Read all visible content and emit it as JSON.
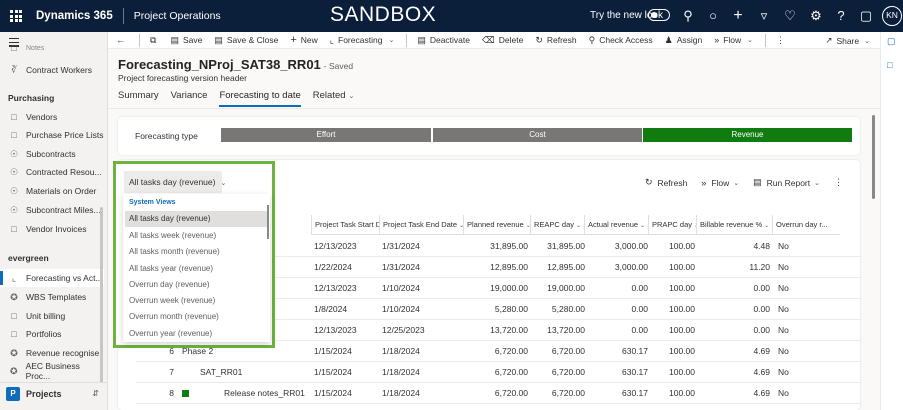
{
  "topbar": {
    "brand": "Dynamics 365",
    "app": "Project Operations",
    "banner": "SANDBOX",
    "try_new_look": "Try the new look",
    "avatar": "KN"
  },
  "sidebar": {
    "top_items": [
      {
        "label": "Notes",
        "icon": "note-icon"
      },
      {
        "label": "Contract Workers",
        "icon": "people-icon"
      }
    ],
    "purchasing_heading": "Purchasing",
    "purchasing_items": [
      {
        "label": "Vendors",
        "icon": "vendor-icon"
      },
      {
        "label": "Purchase Price Lists",
        "icon": "price-list-icon"
      },
      {
        "label": "Subcontracts",
        "icon": "cart-icon"
      },
      {
        "label": "Contracted Resou...",
        "icon": "cart-icon"
      },
      {
        "label": "Materials on Order",
        "icon": "cart-icon"
      },
      {
        "label": "Subcontract Miles...",
        "icon": "cart-icon"
      },
      {
        "label": "Vendor Invoices",
        "icon": "invoice-icon"
      }
    ],
    "evergreen_heading": "evergreen",
    "evergreen_items": [
      {
        "label": "Forecasting vs Act...",
        "icon": "chart-icon",
        "active": true
      },
      {
        "label": "WBS Templates",
        "icon": "puzzle-icon"
      },
      {
        "label": "Unit billing",
        "icon": "document-icon"
      },
      {
        "label": "Portfolios",
        "icon": "document-icon"
      },
      {
        "label": "Revenue recognise",
        "icon": "puzzle-icon"
      },
      {
        "label": "AEC Business Proc...",
        "icon": "puzzle-icon"
      }
    ],
    "area": {
      "badge": "P",
      "label": "Projects"
    }
  },
  "commandbar": {
    "items": [
      {
        "label": "Save",
        "icon": "save-icon"
      },
      {
        "label": "Save & Close",
        "icon": "save-close-icon"
      },
      {
        "label": "New",
        "icon": "plus-icon"
      },
      {
        "label": "Forecasting",
        "icon": "chart-icon",
        "dropdown": true
      },
      {
        "label": "Deactivate",
        "icon": "deactivate-icon"
      },
      {
        "label": "Delete",
        "icon": "trash-icon"
      },
      {
        "label": "Refresh",
        "icon": "refresh-icon"
      },
      {
        "label": "Check Access",
        "icon": "key-icon"
      },
      {
        "label": "Assign",
        "icon": "assign-icon"
      },
      {
        "label": "Flow",
        "icon": "flow-icon",
        "dropdown": true
      }
    ],
    "share": "Share"
  },
  "record": {
    "title": "Forecasting_NProj_SAT38_RR01",
    "saved": "- Saved",
    "subtitle": "Project forecasting version header"
  },
  "tabs": [
    {
      "label": "Summary"
    },
    {
      "label": "Variance"
    },
    {
      "label": "Forecasting to date",
      "selected": true
    },
    {
      "label": "Related",
      "dropdown": true
    }
  ],
  "forecasting_type": {
    "label": "Forecasting type",
    "options": [
      {
        "label": "Effort",
        "color": "#797775"
      },
      {
        "label": "Cost",
        "color": "#797775"
      },
      {
        "label": "Revenue",
        "color": "#107c10"
      }
    ]
  },
  "grid": {
    "view_selector": "All tasks day (revenue)",
    "tools": [
      {
        "label": "Refresh",
        "icon": "refresh-icon"
      },
      {
        "label": "Flow",
        "icon": "flow-icon",
        "dropdown": true
      },
      {
        "label": "Run Report",
        "icon": "report-icon",
        "dropdown": true
      }
    ],
    "columns": [
      "Project Task Start Date",
      "Project Task End Date",
      "Planned revenue",
      "REAPC day",
      "Actual revenue",
      "PRAPC day",
      "Billable revenue %",
      "Overrun day r..."
    ],
    "rows": [
      {
        "num": "",
        "name": "",
        "start": "12/13/2023",
        "end": "1/31/2024",
        "planned": "31,895.00",
        "reapc": "31,895.00",
        "actual": "3,000.00",
        "prapc": "100.00",
        "billable": "4.48",
        "overrun": "No"
      },
      {
        "num": "",
        "name": "",
        "start": "1/22/2024",
        "end": "1/31/2024",
        "planned": "12,895.00",
        "reapc": "12,895.00",
        "actual": "3,000.00",
        "prapc": "100.00",
        "billable": "11.20",
        "overrun": "No"
      },
      {
        "num": "",
        "name": "",
        "start": "12/13/2023",
        "end": "1/10/2024",
        "planned": "19,000.00",
        "reapc": "19,000.00",
        "actual": "0.00",
        "prapc": "100.00",
        "billable": "0.00",
        "overrun": "No"
      },
      {
        "num": "",
        "name": "",
        "start": "1/8/2024",
        "end": "1/10/2024",
        "planned": "5,280.00",
        "reapc": "5,280.00",
        "actual": "0.00",
        "prapc": "100.00",
        "billable": "0.00",
        "overrun": "No"
      },
      {
        "num": "",
        "name": "",
        "start": "12/13/2023",
        "end": "12/25/2023",
        "planned": "13,720.00",
        "reapc": "13,720.00",
        "actual": "0.00",
        "prapc": "100.00",
        "billable": "0.00",
        "overrun": "No"
      },
      {
        "num": "6",
        "name": "Phase 2",
        "start": "1/15/2024",
        "end": "1/18/2024",
        "planned": "6,720.00",
        "reapc": "6,720.00",
        "actual": "630.17",
        "prapc": "100.00",
        "billable": "4.69",
        "overrun": "No"
      },
      {
        "num": "7",
        "name": "SAT_RR01",
        "start": "1/15/2024",
        "end": "1/18/2024",
        "planned": "6,720.00",
        "reapc": "6,720.00",
        "actual": "630.17",
        "prapc": "100.00",
        "billable": "4.69",
        "overrun": "No"
      },
      {
        "num": "8",
        "name": "Release notes_RR01",
        "start": "1/15/2024",
        "end": "1/18/2024",
        "planned": "6,720.00",
        "reapc": "6,720.00",
        "actual": "630.17",
        "prapc": "100.00",
        "billable": "4.69",
        "overrun": "No"
      }
    ]
  },
  "views_menu": {
    "heading": "System Views",
    "items": [
      "All tasks day (revenue)",
      "All tasks week (revenue)",
      "All tasks month (revenue)",
      "All tasks year (revenue)",
      "Overrun day (revenue)",
      "Overrun week (revenue)",
      "Overrun month (revenue)",
      "Overrun year (revenue)"
    ],
    "selected_index": 0
  }
}
